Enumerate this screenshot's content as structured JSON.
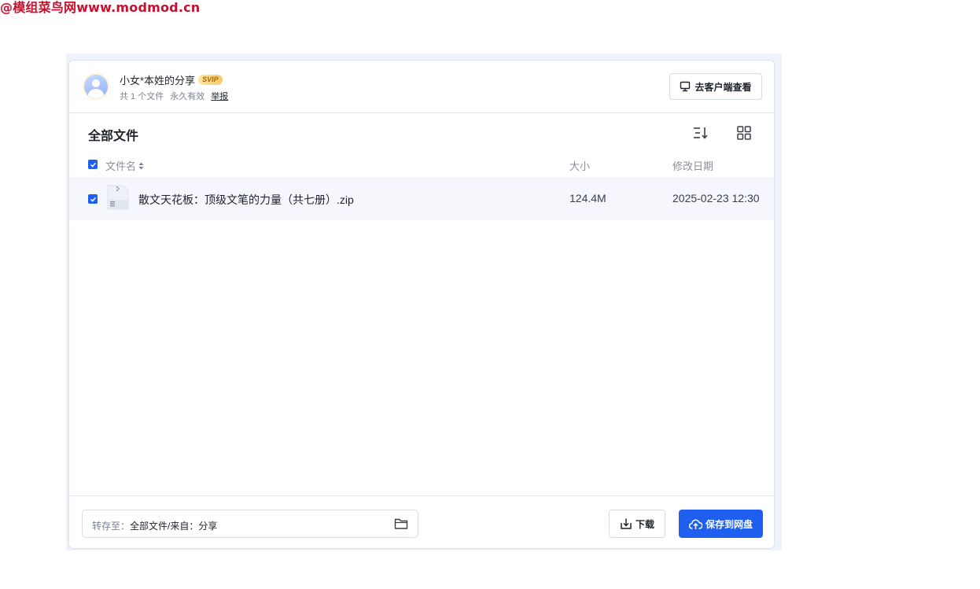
{
  "watermark": "@模组菜鸟网www.modmod.cn",
  "share": {
    "owner": "小女*本姓的分享",
    "badge": "SVIP",
    "file_count": "共 1 个文件",
    "validity": "永久有效",
    "report": "举报",
    "client_button": "去客户端查看"
  },
  "list": {
    "title": "全部文件",
    "columns": {
      "name": "文件名",
      "size": "大小",
      "date": "修改日期"
    },
    "files": [
      {
        "name": "散文天花板：顶级文笔的力量（共七册）.zip",
        "size": "124.4M",
        "date": "2025-02-23 12:30",
        "checked": true
      }
    ]
  },
  "footer": {
    "save_label": "转存至：",
    "save_path": "全部文件/来自：分享",
    "download": "下载",
    "save_button": "保存到网盘"
  },
  "colors": {
    "accent": "#1f5ff0",
    "watermark": "#c8102e"
  }
}
